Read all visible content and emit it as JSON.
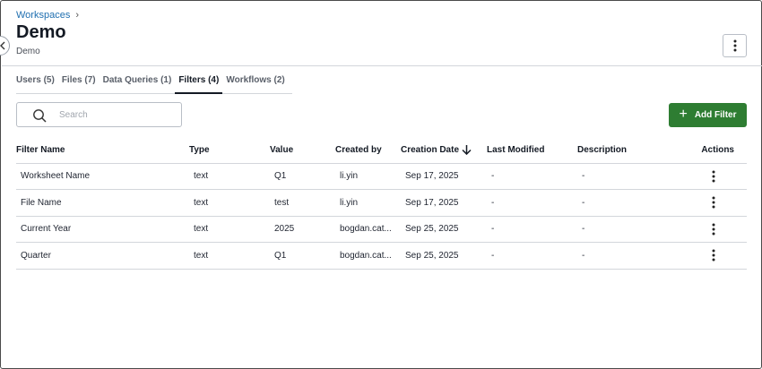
{
  "breadcrumb": {
    "root": "Workspaces",
    "chevron": "›"
  },
  "page": {
    "title": "Demo",
    "subtitle": "Demo"
  },
  "tabs": [
    {
      "label": "Users (5)",
      "active": false
    },
    {
      "label": "Files (7)",
      "active": false
    },
    {
      "label": "Data Queries (1)",
      "active": false
    },
    {
      "label": "Filters (4)",
      "active": true
    },
    {
      "label": "Workflows (2)",
      "active": false
    }
  ],
  "search": {
    "placeholder": "Search",
    "value": ""
  },
  "toolbar": {
    "add_label": "Add Filter",
    "add_icon": "plus-icon"
  },
  "colors": {
    "accent": "#2e7d32",
    "link": "#1f6fb0",
    "divider": "#d3d6db"
  },
  "table": {
    "columns": [
      "Filter Name",
      "Type",
      "Value",
      "Created by",
      "Creation Date",
      "Last Modified",
      "Description",
      "Actions"
    ],
    "sort_icon": "arrow-down-icon",
    "rows": [
      {
        "name": "Worksheet Name",
        "type": "text",
        "value": "Q1",
        "created_by": "li.yin",
        "creation_date": "Sep 17, 2025",
        "last_modified": "-",
        "description": "-"
      },
      {
        "name": "File Name",
        "type": "text",
        "value": "test",
        "created_by": "li.yin",
        "creation_date": "Sep 17, 2025",
        "last_modified": "-",
        "description": "-"
      },
      {
        "name": "Current Year",
        "type": "text",
        "value": "2025",
        "created_by": "bogdan.cat...",
        "creation_date": "Sep 25, 2025",
        "last_modified": "-",
        "description": "-"
      },
      {
        "name": "Quarter",
        "type": "text",
        "value": "Q1",
        "created_by": "bogdan.cat...",
        "creation_date": "Sep 25, 2025",
        "last_modified": "-",
        "description": "-"
      }
    ]
  }
}
